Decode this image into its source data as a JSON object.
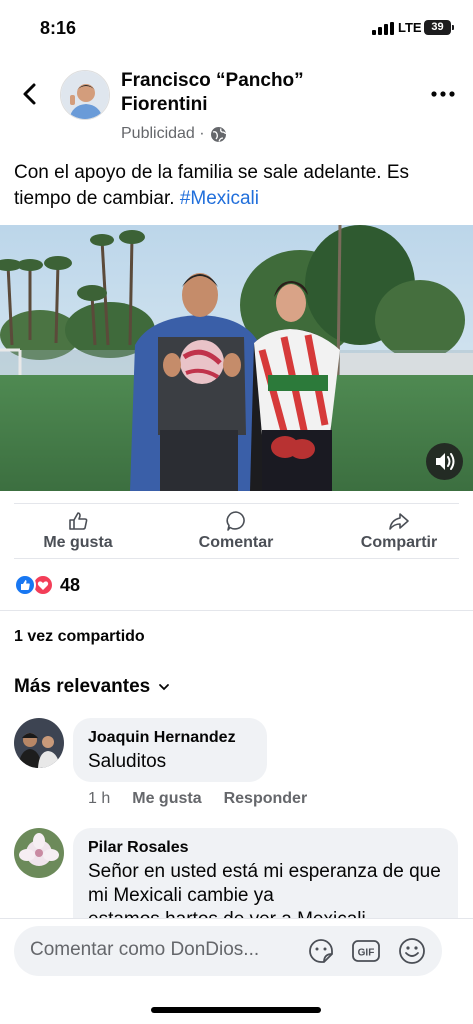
{
  "status_bar": {
    "time": "8:16",
    "network": "LTE",
    "battery": "39"
  },
  "post": {
    "author": "Francisco “Pancho” Fiorentini",
    "meta": "Publicidad ·",
    "text": "Con el apoyo de la familia se sale adelante. Es tiempo de cambiar.",
    "hashtag": "#Mexicali"
  },
  "actions": {
    "like": "Me gusta",
    "comment": "Comentar",
    "share": "Compartir"
  },
  "reactions": {
    "count": "48"
  },
  "shares": "1 vez compartido",
  "sort_label": "Más relevantes",
  "comments": [
    {
      "name": "Joaquin Hernandez",
      "text": "Saluditos",
      "time": "1 h",
      "like": "Me gusta",
      "reply": "Responder"
    },
    {
      "name": "Pilar Rosales",
      "text": "Señor en usted está mi esperanza de que mi Mexicali cambie ya",
      "text_partial": "estamos hartos de ver a Mexicali"
    }
  ],
  "composer": {
    "placeholder": "Comentar como DonDios..."
  },
  "colors": {
    "accent": "#1877f2",
    "hashtag": "#216fdb",
    "love": "#f33e58",
    "bubble": "#f0f2f5"
  },
  "icons": [
    "back-arrow-icon",
    "globe-icon",
    "more-icon",
    "sound-icon",
    "like-icon",
    "comment-icon",
    "share-icon",
    "chevron-down-icon",
    "sticker-icon",
    "gif-icon",
    "emoji-icon"
  ]
}
